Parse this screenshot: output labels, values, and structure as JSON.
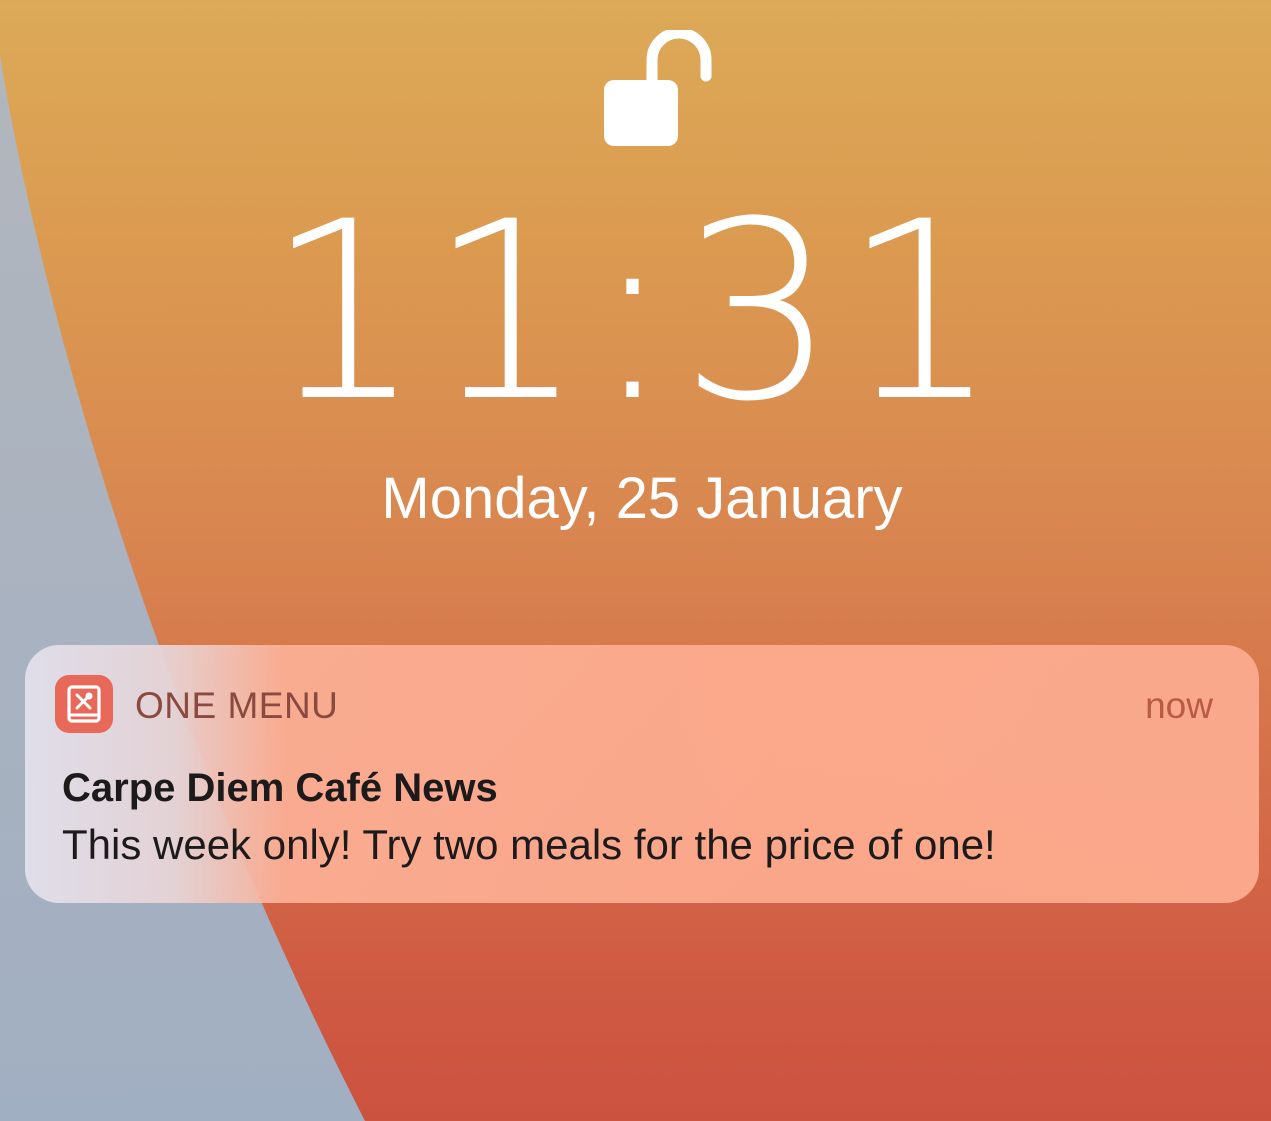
{
  "lock_screen": {
    "time": "11:31",
    "date": "Monday, 25 January",
    "lock_icon": "unlocked-padlock-icon"
  },
  "notification": {
    "app_icon": "one-menu-app-icon",
    "app_name": "ONE MENU",
    "time": "now",
    "title": "Carpe Diem Café News",
    "body": "This week only! Try two meals for the price of one!"
  },
  "colors": {
    "wallpaper_top": "#dcaa58",
    "wallpaper_bottom": "#cc5240",
    "wallpaper_side": "#a4b1c2",
    "app_icon_bg": "#e8685a",
    "notification_bg": "#fcac90"
  }
}
